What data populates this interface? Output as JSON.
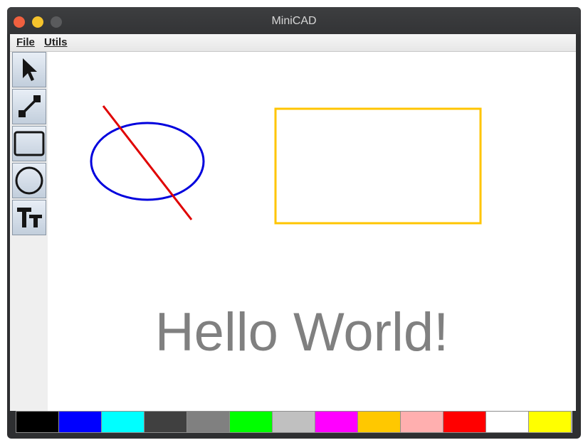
{
  "window": {
    "title": "MiniCAD"
  },
  "menu": {
    "items": [
      "File",
      "Utils"
    ]
  },
  "toolbar": {
    "tools": [
      "select-tool",
      "line-tool",
      "rectangle-tool",
      "ellipse-tool",
      "text-tool"
    ]
  },
  "canvas": {
    "text": "Hello World!",
    "shapes": {
      "line_color": "#e00000",
      "ellipse_color": "#0000dd",
      "rectangle_color": "#ffc500",
      "text_color": "#808080"
    }
  },
  "palette": {
    "colors": [
      "#000000",
      "#0000ff",
      "#00ffff",
      "#404040",
      "#808080",
      "#00ff00",
      "#c0c0c0",
      "#ff00ff",
      "#ffc800",
      "#ffafaf",
      "#ff0000",
      "#ffffff",
      "#ffff00"
    ]
  }
}
